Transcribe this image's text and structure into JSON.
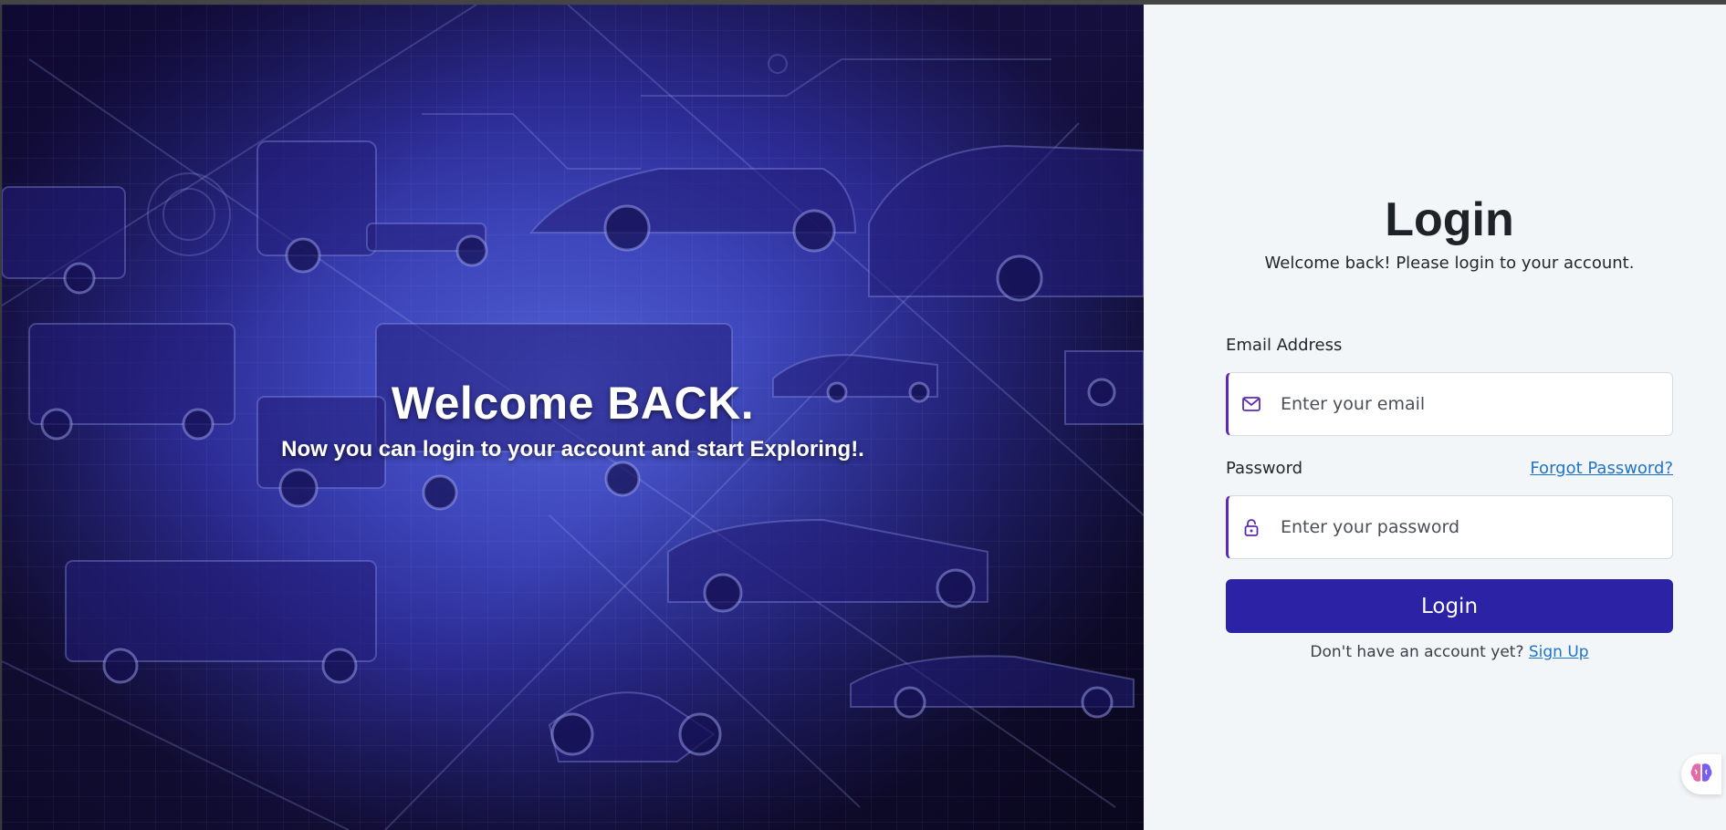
{
  "hero": {
    "title": "Welcome BACK.",
    "subtitle": "Now you can login to your account and start Exploring!."
  },
  "login": {
    "title": "Login",
    "subtitle": "Welcome back! Please login to your account.",
    "email_label": "Email Address",
    "email_placeholder": "Enter your email",
    "email_icon": "mail-icon",
    "password_label": "Password",
    "password_placeholder": "Enter your password",
    "password_icon": "lock-icon",
    "forgot_label": "Forgot Password?",
    "button_label": "Login",
    "signup_prompt": "Don't have an account yet?",
    "signup_label": "Sign Up"
  },
  "colors": {
    "accent": "#5b2bb5",
    "button": "#2b22a6",
    "link": "#1f74c9",
    "panel_bg": "#f3f6f9",
    "hero_bg": "#3c44b8"
  },
  "assistant": {
    "icon": "brain-icon"
  }
}
